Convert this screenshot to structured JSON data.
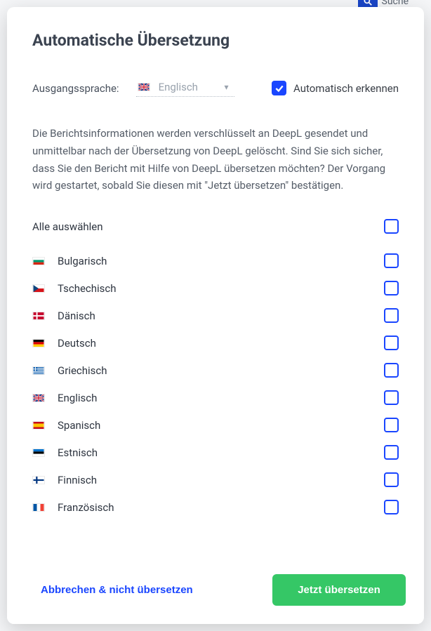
{
  "title": "Automatische Übersetzung",
  "source": {
    "label": "Ausgangssprache:",
    "value": "Englisch",
    "flag": "gb"
  },
  "auto": {
    "label": "Automatisch erkennen",
    "checked": true
  },
  "description": "Die Berichtsinformationen werden verschlüsselt an DeepL gesendet und unmittelbar nach der Übersetzung von DeepL gelöscht. Sind Sie sich sicher, dass Sie den Bericht mit Hilfe von DeepL übersetzen möchten? Der Vorgang wird gestartet, sobald Sie diesen mit \"Jetzt übersetzen\" bestätigen.",
  "select_all_label": "Alle auswählen",
  "languages": [
    {
      "flag": "bg",
      "name": "Bulgarisch",
      "checked": false
    },
    {
      "flag": "cz",
      "name": "Tschechisch",
      "checked": false
    },
    {
      "flag": "dk",
      "name": "Dänisch",
      "checked": false
    },
    {
      "flag": "de",
      "name": "Deutsch",
      "checked": false
    },
    {
      "flag": "gr",
      "name": "Griechisch",
      "checked": false
    },
    {
      "flag": "gb",
      "name": "Englisch",
      "checked": false
    },
    {
      "flag": "es",
      "name": "Spanisch",
      "checked": false
    },
    {
      "flag": "ee",
      "name": "Estnisch",
      "checked": false
    },
    {
      "flag": "fi",
      "name": "Finnisch",
      "checked": false
    },
    {
      "flag": "fr",
      "name": "Französisch",
      "checked": false
    }
  ],
  "footer": {
    "cancel": "Abbrechen & nicht übersetzen",
    "confirm": "Jetzt übersetzen"
  },
  "bg": {
    "search_label": "Suche"
  }
}
